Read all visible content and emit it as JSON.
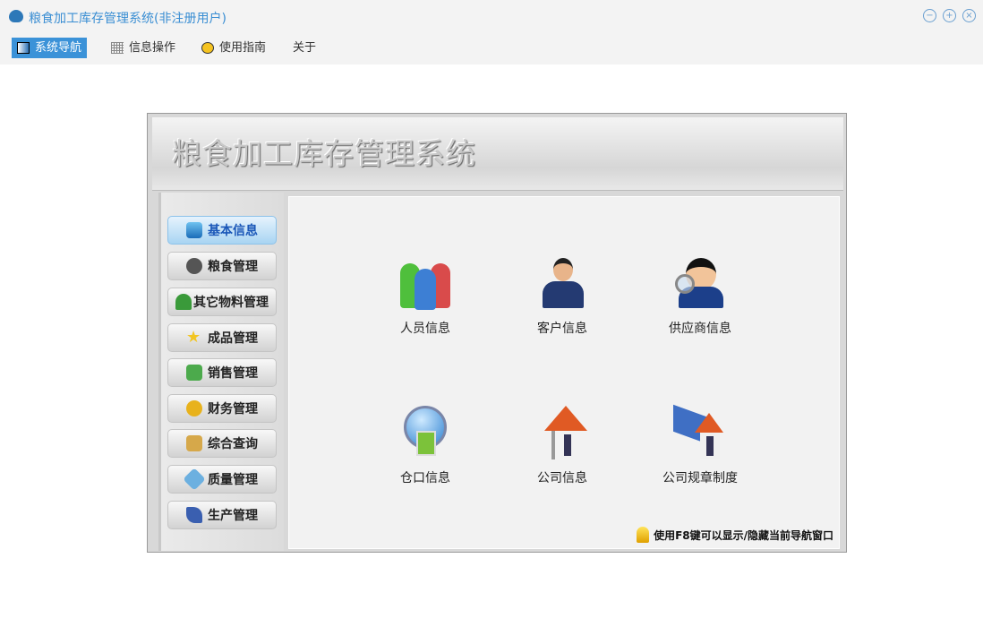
{
  "window": {
    "title": "粮食加工库存管理系统(非注册用户)",
    "min": "−",
    "max": "+",
    "close": "×"
  },
  "menu": [
    {
      "label": "系统导航"
    },
    {
      "label": "信息操作"
    },
    {
      "label": "使用指南"
    },
    {
      "label": "关于"
    }
  ],
  "header": {
    "title": "粮食加工库存管理系统"
  },
  "sidebar": [
    {
      "label": "基本信息"
    },
    {
      "label": "粮食管理"
    },
    {
      "label": "其它物料管理"
    },
    {
      "label": "成品管理"
    },
    {
      "label": "销售管理"
    },
    {
      "label": "财务管理"
    },
    {
      "label": "综合查询"
    },
    {
      "label": "质量管理"
    },
    {
      "label": "生产管理"
    }
  ],
  "tiles": [
    {
      "label": "人员信息"
    },
    {
      "label": "客户信息"
    },
    {
      "label": "供应商信息"
    },
    {
      "label": "仓口信息"
    },
    {
      "label": "公司信息"
    },
    {
      "label": "公司规章制度"
    }
  ],
  "hint": "使用F8键可以显示/隐藏当前导航窗口"
}
